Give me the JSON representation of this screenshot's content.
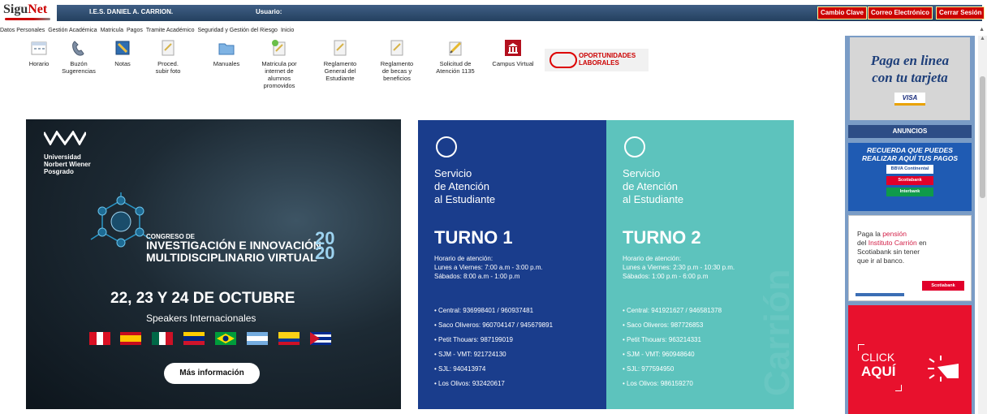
{
  "header": {
    "logo_main": "Sigu",
    "logo_accent": "Net",
    "institution": "I.E.S. DANIEL A. CARRION.",
    "user_label": "Usuario:",
    "buttons": {
      "change_password": "Cambio Clave",
      "email": "Correo Electrónico",
      "logout": "Cerrar Sesión"
    }
  },
  "menu": {
    "items": [
      "Datos Personales",
      "Gestión Académica",
      "Matricula",
      "Pagos",
      "Tramite Académico",
      "Seguridad y Gestión del Riesgo",
      "Inicio"
    ]
  },
  "toolbar": {
    "items": [
      {
        "label": "Horario",
        "icon": "calendar-icon"
      },
      {
        "label": "Buzón Sugerencias",
        "icon": "phone-icon"
      },
      {
        "label": "Notas",
        "icon": "notes-icon"
      },
      {
        "label": "Proced. subir foto",
        "icon": "document-icon"
      },
      {
        "label": "Manuales",
        "icon": "folder-icon"
      },
      {
        "label": "Matricula por internet de alumnos promovidos",
        "icon": "document-check-icon"
      },
      {
        "label": "Reglamento General del Estudiante",
        "icon": "document-icon"
      },
      {
        "label": "Reglamento de becas y beneficios",
        "icon": "document-icon"
      },
      {
        "label": "Solicitud de Atención 1135",
        "icon": "pencil-icon"
      },
      {
        "label": "Campus Virtual",
        "icon": "building-icon"
      }
    ],
    "opportunities": "OPORTUNIDADES LABORALES"
  },
  "banner_left": {
    "university_line1": "Universidad",
    "university_line2": "Norbert Wiener",
    "university_line3": "Posgrado",
    "congress_small": "CONGRESO DE",
    "congress_line1": "INVESTIGACIÓN E INNOVACIÓN",
    "congress_line2": "MULTIDISCIPLINARIO VIRTUAL",
    "year_top": "20",
    "year_bottom": "20",
    "dates": "22, 23 Y 24 DE OCTUBRE",
    "speakers": "Speakers Internacionales",
    "cta": "Más información"
  },
  "banner_right": {
    "service_line1": "Servicio",
    "service_line2": "de Atención",
    "service_line3": "al Estudiante",
    "watermark": "Carrión",
    "turno1": {
      "title": "TURNO 1",
      "hours_title": "Horario de atención:",
      "weekdays": "Lunes a Viernes: 7:00 a.m - 3:00 p.m.",
      "saturday": "Sábados: 8:00 a.m - 1:00 p.m",
      "contacts": [
        "Central: 936998401 / 960937481",
        "Saco Oliveros: 960704147 / 945679891",
        "Petit Thouars: 987199019",
        "SJM - VMT: 921724130",
        "SJL: 940413974",
        "Los Olivos: 932420617"
      ]
    },
    "turno2": {
      "title": "TURNO 2",
      "hours_title": "Horario de atención:",
      "weekdays": "Lunes a Viernes: 2:30 p.m - 10:30 p.m.",
      "saturday": "Sábados: 1:00 p.m - 6:00 p.m",
      "contacts": [
        "Central: 941921627 / 946581378",
        "Saco Oliveros: 987726853",
        "Petit Thouars: 963214331",
        "SJM - VMT: 960948640",
        "SJL: 977594950",
        "Los Olivos: 986159270"
      ]
    }
  },
  "sidebar": {
    "pay_line1": "Paga en linea",
    "pay_line2": "con tu tarjeta",
    "visa": "VISA",
    "announcements": "ANUNCIOS",
    "ad1_line1": "RECUERDA QUE PUEDES",
    "ad1_line2": "REALIZAR AQUÍ TUS PAGOS",
    "bank1": "BBVA Continental",
    "bank2": "Scotiabank",
    "bank3": "Interbank",
    "ad2_line1a": "Paga la ",
    "ad2_line1b": "pensión",
    "ad2_line2a": "del ",
    "ad2_line2b": "Instituto Carrión",
    "ad2_line2c": " en",
    "ad2_line3": "Scotiabank sin tener",
    "ad2_line4": "que ir al banco.",
    "ad2_bank": "Scotiabank",
    "ad3_line1": "CLICK",
    "ad3_line2": "AQUÍ"
  },
  "colors": {
    "header_blue": "#2f4f75",
    "button_red": "#cc0000",
    "turno1_bg": "#1a3d8c",
    "turno2_bg": "#5dc3bd",
    "rail_blue": "#7a9cc6",
    "click_red": "#e8112d"
  }
}
